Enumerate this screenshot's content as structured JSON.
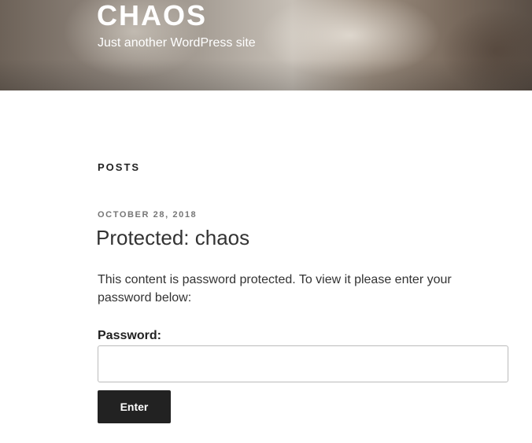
{
  "site": {
    "title": "CHAOS",
    "tagline": "Just another WordPress site"
  },
  "main": {
    "heading": "POSTS",
    "post": {
      "date": "OCTOBER 28, 2018",
      "title": "Protected: chaos",
      "message": "This content is password protected. To view it please enter your password below:"
    },
    "form": {
      "password_label": "Password:",
      "password_value": "",
      "submit_label": "Enter"
    }
  }
}
